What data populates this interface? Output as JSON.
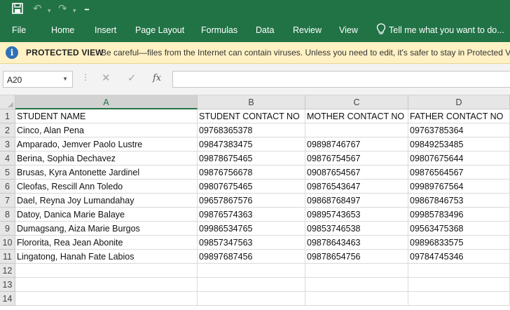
{
  "quick_access": {
    "save_icon": "save-icon",
    "undo_icon": "undo-icon",
    "redo_icon": "redo-icon",
    "customize_icon": "customize-toolbar-icon"
  },
  "ribbon": {
    "tabs": [
      "File",
      "Home",
      "Insert",
      "Page Layout",
      "Formulas",
      "Data",
      "Review",
      "View"
    ],
    "tell_me": "Tell me what you want to do..."
  },
  "protected_view": {
    "title": "PROTECTED VIEW",
    "message": "Be careful—files from the Internet can contain viruses. Unless you need to edit, it's safer to stay in Protected View."
  },
  "formula_bar": {
    "name_box": "A20",
    "cancel_glyph": "✕",
    "enter_glyph": "✓",
    "fx_glyph": "fx",
    "formula": ""
  },
  "sheet": {
    "columns": [
      "A",
      "B",
      "C",
      "D"
    ],
    "selected_column": "A",
    "row_numbers": [
      "1",
      "2",
      "3",
      "4",
      "5",
      "6",
      "7",
      "8",
      "9",
      "10",
      "11",
      "12",
      "13",
      "14"
    ],
    "rows": [
      [
        "STUDENT NAME",
        "STUDENT CONTACT NO",
        "MOTHER CONTACT NO",
        "FATHER CONTACT NO"
      ],
      [
        "Cinco, Alan Pena",
        "09768365378",
        "",
        "09763785364"
      ],
      [
        "Amparado, Jemver Paolo Lustre",
        "09847383475",
        "09898746767",
        "09849253485"
      ],
      [
        "Berina, Sophia Dechavez",
        "09878675465",
        "09876754567",
        "09807675644"
      ],
      [
        "Brusas, Kyra Antonette Jardinel",
        "09876756678",
        "09087654567",
        "09876564567"
      ],
      [
        "Cleofas, Rescill Ann Toledo",
        "09807675465",
        "09876543647",
        "09989767564"
      ],
      [
        "Dael, Reyna Joy Lumandahay",
        "09657867576",
        "09868768497",
        "09867846753"
      ],
      [
        "Datoy, Danica Marie Balaye",
        "09876574363",
        "09895743653",
        "09985783496"
      ],
      [
        "Dumagsang, Aiza Marie Burgos",
        "09986534765",
        "09853746538",
        "09563475368"
      ],
      [
        "Flororita, Rea Jean Abonite",
        "09857347563",
        "09878643463",
        "09896833575"
      ],
      [
        "Lingatong, Hanah Fate Labios",
        "09897687456",
        "09878654756",
        "09784745346"
      ],
      [
        "",
        "",
        "",
        ""
      ],
      [
        "",
        "",
        "",
        ""
      ],
      [
        "",
        "",
        "",
        ""
      ]
    ]
  },
  "colors": {
    "brand_green": "#217346",
    "protected_bar": "#fff1c4",
    "info_icon": "#2f6fb6"
  }
}
